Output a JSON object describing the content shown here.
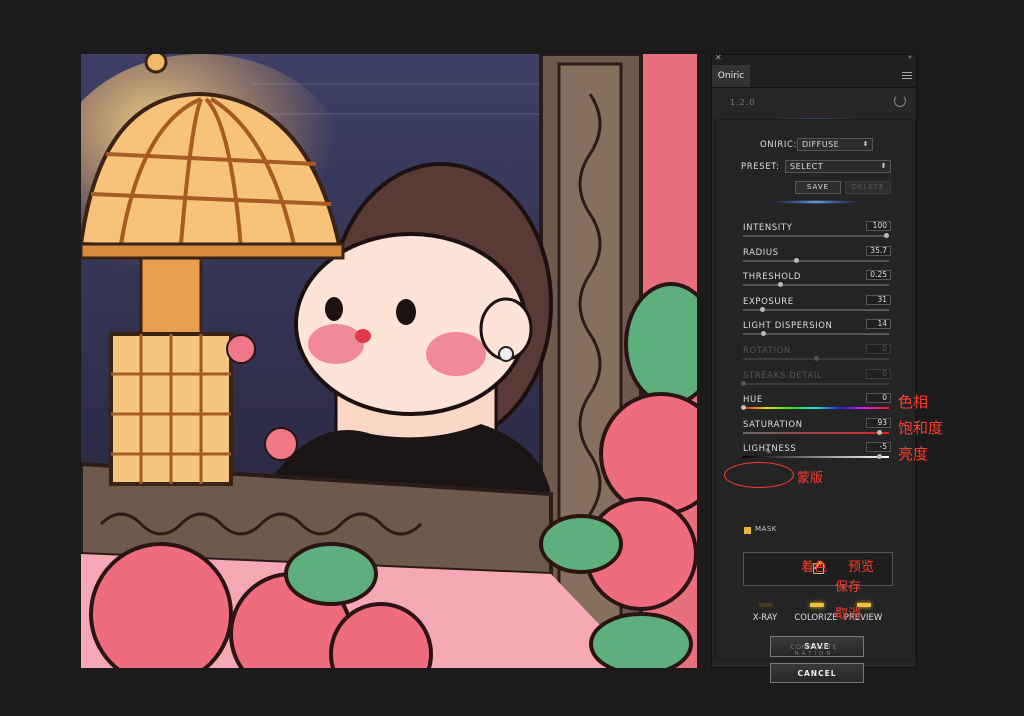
{
  "panel": {
    "tab_title": "Oniric",
    "version": "1.2.0",
    "oniric_label": "ONIRIC:",
    "oniric_value": "DIFFUSE",
    "preset_label": "PRESET:",
    "preset_value": "SELECT",
    "save_preset": "SAVE",
    "delete_preset": "DELETE",
    "sliders": [
      {
        "label": "INTENSITY",
        "value": "100",
        "fraction": 0.98,
        "enabled": true
      },
      {
        "label": "RADIUS",
        "value": "35.7",
        "fraction": 0.36,
        "enabled": true
      },
      {
        "label": "THRESHOLD",
        "value": "0.25",
        "fraction": 0.25,
        "enabled": true
      },
      {
        "label": "EXPOSURE",
        "value": "31",
        "fraction": 0.13,
        "enabled": true
      },
      {
        "label": "LIGHT DISPERSION",
        "value": "14",
        "fraction": 0.14,
        "enabled": true
      },
      {
        "label": "ROTATION",
        "value": "0",
        "fraction": 0.5,
        "enabled": false
      },
      {
        "label": "STREAKS DETAIL",
        "value": "0",
        "fraction": 0.0,
        "enabled": false
      },
      {
        "label": "HUE",
        "value": "0",
        "fraction": 0.0,
        "enabled": true
      },
      {
        "label": "SATURATION",
        "value": "93",
        "fraction": 0.93,
        "enabled": true
      },
      {
        "label": "LIGHTNESS",
        "value": "-5",
        "fraction": 0.93,
        "enabled": true
      }
    ],
    "mask_label": "MASK",
    "toggles": [
      {
        "label": "X-RAY",
        "on": false
      },
      {
        "label": "COLORIZE",
        "on": true
      },
      {
        "label": "PREVIEW",
        "on": true
      }
    ],
    "save_button": "SAVE",
    "cancel_button": "CANCEL",
    "footer_line1": "COMPOSITE",
    "footer_line2": "NATION"
  },
  "annotations": {
    "hue": "色相",
    "saturation": "饱和度",
    "lightness": "亮度",
    "mask": "蒙版",
    "colorize": "着色",
    "preview": "预览",
    "save": "保存",
    "cancel": "取消"
  },
  "colors": {
    "accent": "#f3c040",
    "annotation": "#ff3b2f",
    "panel_bg": "#262626"
  }
}
